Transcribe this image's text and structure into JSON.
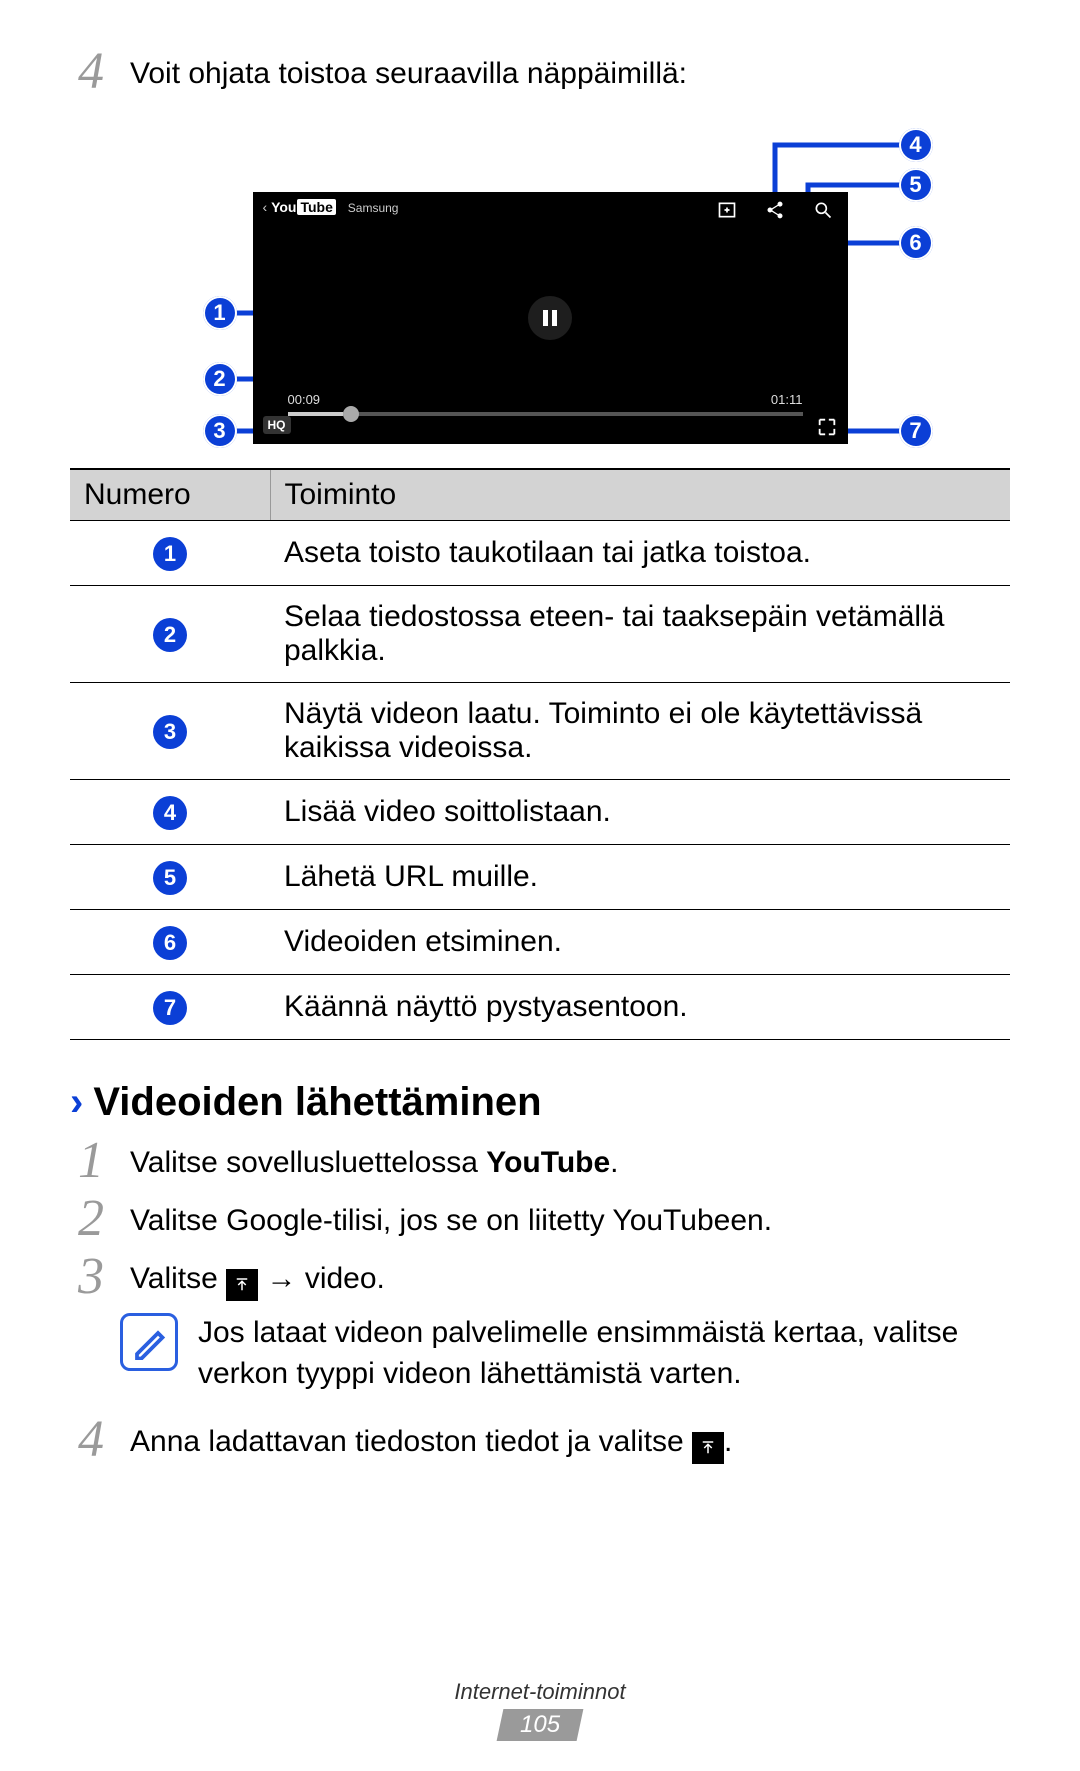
{
  "steps_top": {
    "num": "4",
    "text": "Voit ohjata toistoa seuraavilla näppäimillä:"
  },
  "figure": {
    "youtube_brand": "Samsung",
    "time_current": "00:09",
    "time_total": "01:11",
    "hq_label": "HQ",
    "callouts": [
      "1",
      "2",
      "3",
      "4",
      "5",
      "6",
      "7"
    ]
  },
  "table": {
    "head_num": "Numero",
    "head_func": "Toiminto",
    "rows": [
      {
        "n": "1",
        "t": "Aseta toisto taukotilaan tai jatka toistoa."
      },
      {
        "n": "2",
        "t": "Selaa tiedostossa eteen- tai taaksepäin vetämällä palkkia."
      },
      {
        "n": "3",
        "t": "Näytä videon laatu. Toiminto ei ole käytettävissä kaikissa videoissa."
      },
      {
        "n": "4",
        "t": "Lisää video soittolistaan."
      },
      {
        "n": "5",
        "t": "Lähetä URL muille."
      },
      {
        "n": "6",
        "t": "Videoiden etsiminen."
      },
      {
        "n": "7",
        "t": "Käännä näyttö pystyasentoon."
      }
    ]
  },
  "section2": {
    "title": "Videoiden lähettäminen",
    "step1_num": "1",
    "step1_pre": "Valitse sovellusluettelossa ",
    "step1_bold": "YouTube",
    "step1_post": ".",
    "step2_num": "2",
    "step2_text": "Valitse Google-tilisi, jos se on liitetty YouTubeen.",
    "step3_num": "3",
    "step3_pre": "Valitse ",
    "step3_post": " → video.",
    "note": "Jos lataat videon palvelimelle ensimmäistä kertaa, valitse verkon tyyppi videon lähettämistä varten.",
    "step4_num": "4",
    "step4_pre": "Anna ladattavan tiedoston tiedot ja valitse ",
    "step4_post": "."
  },
  "footer": {
    "category": "Internet-toiminnot",
    "page": "105"
  }
}
